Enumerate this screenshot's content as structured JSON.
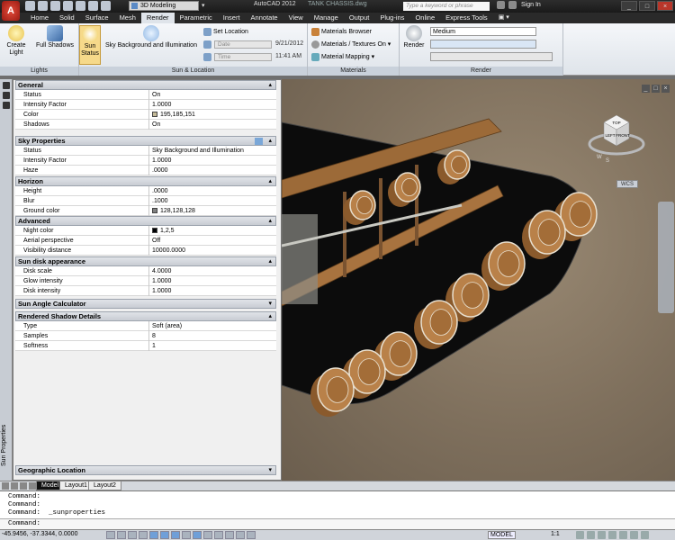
{
  "titlebar": {
    "app_letter": "A",
    "workspace": "3D Modeling",
    "title": "AutoCAD 2012",
    "document": "TANK CHASSIS.dwg",
    "search_placeholder": "Type a keyword or phrase",
    "signin": "Sign In"
  },
  "tabs": [
    "Home",
    "Solid",
    "Surface",
    "Mesh",
    "Render",
    "Parametric",
    "Insert",
    "Annotate",
    "View",
    "Manage",
    "Output",
    "Plug-ins",
    "Online",
    "Express Tools"
  ],
  "ribbon": {
    "lights": {
      "title": "Lights",
      "create_light": "Create Light",
      "full_shadows": "Full Shadows"
    },
    "sun": {
      "title": "Sun & Location",
      "sun_status": "Sun Status",
      "sky": "Sky Background and Illumination",
      "set_location": "Set Location",
      "date_label": "Date",
      "date_value": "9/21/2012",
      "time_label": "Time",
      "time_value": "11:41 AM"
    },
    "materials": {
      "title": "Materials",
      "browser": "Materials Browser",
      "textures": "Materials / Textures On",
      "mapping": "Material Mapping"
    },
    "render": {
      "title": "Render",
      "render_btn": "Render",
      "quality": "Medium"
    }
  },
  "palette": {
    "vertical_title": "Sun Properties",
    "general": {
      "title": "General",
      "rows": [
        {
          "label": "Status",
          "value": "On"
        },
        {
          "label": "Intensity Factor",
          "value": "1.0000"
        },
        {
          "label": "Color",
          "value": "195,185,151"
        },
        {
          "label": "Shadows",
          "value": "On"
        }
      ]
    },
    "sky": {
      "title": "Sky Properties",
      "rows": [
        {
          "label": "Status",
          "value": "Sky Background and Illumination"
        },
        {
          "label": "Intensity Factor",
          "value": "1.0000"
        },
        {
          "label": "Haze",
          "value": ".0000"
        }
      ]
    },
    "horizon": {
      "title": "Horizon",
      "rows": [
        {
          "label": "Height",
          "value": ".0000"
        },
        {
          "label": "Blur",
          "value": ".1000"
        },
        {
          "label": "Ground color",
          "value": "128,128,128"
        }
      ]
    },
    "advanced": {
      "title": "Advanced",
      "rows": [
        {
          "label": "Night color",
          "value": "1,2,5"
        },
        {
          "label": "Aerial perspective",
          "value": "Off"
        },
        {
          "label": "Visibility distance",
          "value": "10000.0000"
        }
      ]
    },
    "disk": {
      "title": "Sun disk appearance",
      "rows": [
        {
          "label": "Disk scale",
          "value": "4.0000"
        },
        {
          "label": "Glow intensity",
          "value": "1.0000"
        },
        {
          "label": "Disk intensity",
          "value": "1.0000"
        }
      ]
    },
    "angle": {
      "title": "Sun Angle Calculator"
    },
    "shadow": {
      "title": "Rendered Shadow Details",
      "rows": [
        {
          "label": "Type",
          "value": "Soft (area)"
        },
        {
          "label": "Samples",
          "value": "8"
        },
        {
          "label": "Softness",
          "value": "1"
        }
      ]
    },
    "geo": {
      "title": "Geographic Location"
    }
  },
  "swatches": {
    "sun_color": "#c3b997",
    "ground_color": "#808080",
    "night_color": "#010205"
  },
  "viewport": {
    "viewcube_top": "TOP",
    "viewcube_left": "LEFT",
    "viewcube_front": "FRONT",
    "compass_s": "S",
    "compass_w": "W",
    "wcs": "WCS"
  },
  "layout_tabs": [
    "Model",
    "Layout1",
    "Layout2"
  ],
  "command_lines": [
    "Command:",
    "Command:",
    "Command:  _sunproperties"
  ],
  "command_prompt": "Command:",
  "status": {
    "coords": "-45.9456, -37.3344, 0.0000",
    "model": "MODEL",
    "scale": "1:1"
  }
}
